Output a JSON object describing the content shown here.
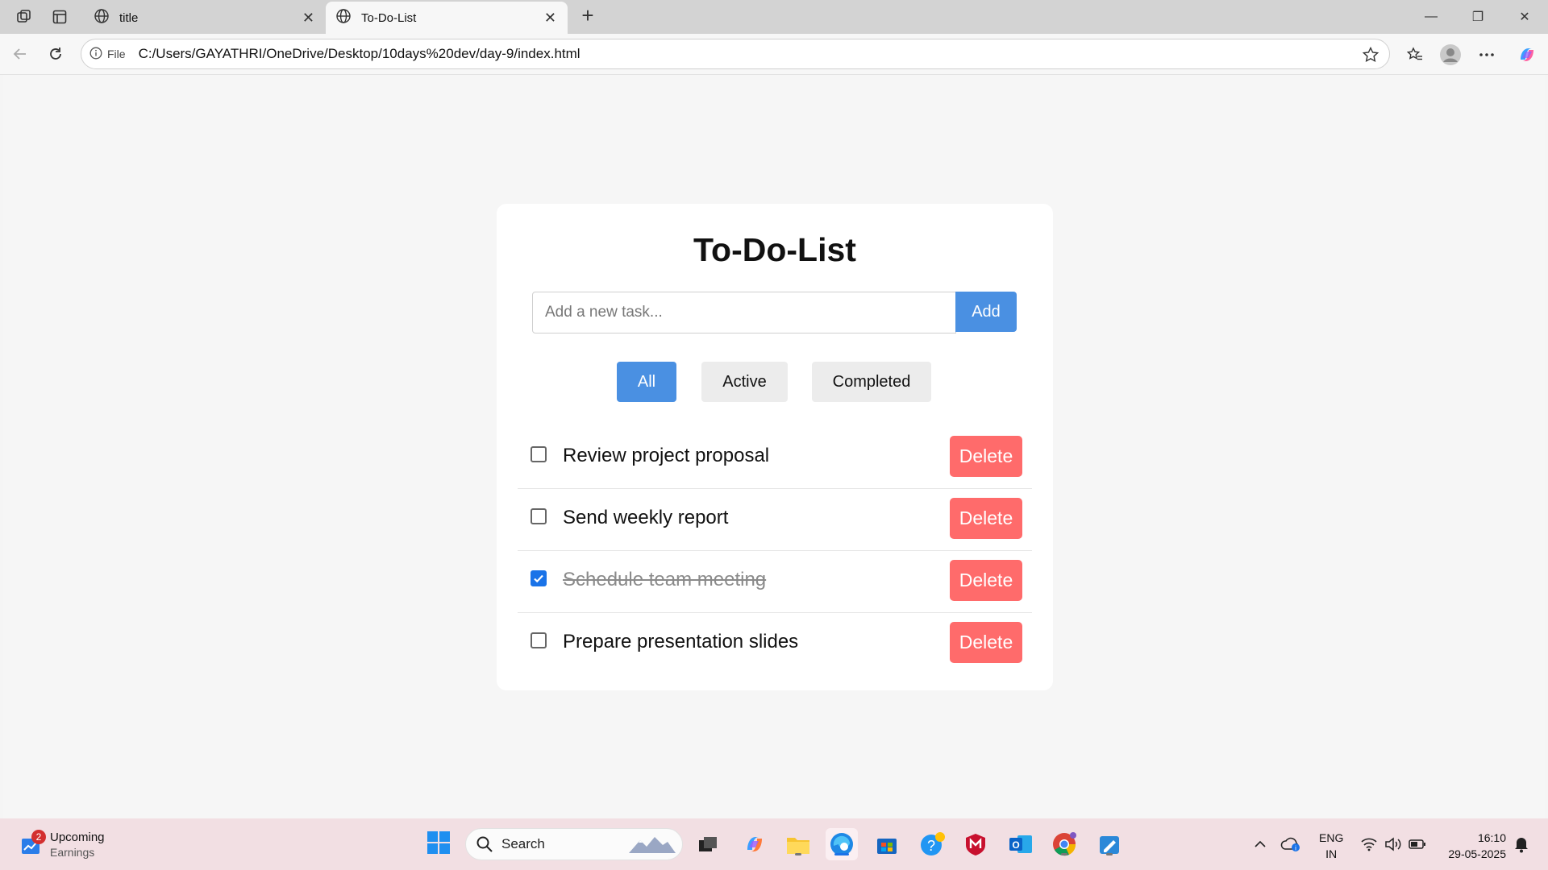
{
  "browser": {
    "tabs": [
      {
        "title": "title"
      },
      {
        "title": "To-Do-List"
      }
    ],
    "address_chip": "File",
    "url": "C:/Users/GAYATHRI/OneDrive/Desktop/10days%20dev/day-9/index.html"
  },
  "app": {
    "title": "To-Do-List",
    "input_placeholder": "Add a new task...",
    "add_label": "Add",
    "filters": [
      {
        "label": "All",
        "selected": true
      },
      {
        "label": "Active",
        "selected": false
      },
      {
        "label": "Completed",
        "selected": false
      }
    ],
    "tasks": [
      {
        "text": "Review project proposal",
        "completed": false,
        "delete_label": "Delete"
      },
      {
        "text": "Send weekly report",
        "completed": false,
        "delete_label": "Delete"
      },
      {
        "text": "Schedule team meeting",
        "completed": true,
        "delete_label": "Delete"
      },
      {
        "text": "Prepare presentation slides",
        "completed": false,
        "delete_label": "Delete"
      }
    ],
    "colors": {
      "primary": "#4a90e2",
      "delete": "#ff6b6b",
      "checkbox_checked": "#1a73e8"
    }
  },
  "taskbar": {
    "widget": {
      "title": "Upcoming",
      "subtitle": "Earnings",
      "badge": "2"
    },
    "search_label": "Search",
    "lang": {
      "line1": "ENG",
      "line2": "IN"
    },
    "clock": {
      "time": "16:10",
      "date": "29-05-2025"
    }
  }
}
